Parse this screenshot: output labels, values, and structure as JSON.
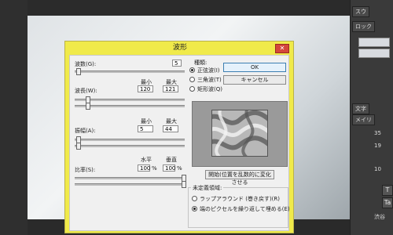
{
  "photoshop": {
    "right_panel_tabs": [
      "スウ",
      "ロック",
      "文字",
      "メイリ"
    ],
    "right_values": [
      "35",
      "19",
      "10"
    ],
    "right_buttons": [
      "T",
      "Ta"
    ],
    "bottom_right_label": "渋谷"
  },
  "dialog": {
    "title": "波形",
    "close_label": "✕",
    "generators": {
      "label": "波数(G):",
      "value": "5"
    },
    "wavelength": {
      "label": "波長(W):",
      "min_label": "最小",
      "max_label": "最大",
      "min": "120",
      "max": "121"
    },
    "amplitude": {
      "label": "振幅(A):",
      "min_label": "最小",
      "max_label": "最大",
      "min": "5",
      "max": "44"
    },
    "scale": {
      "label": "比率(S):",
      "h_label": "水平",
      "v_label": "垂直",
      "h": "100",
      "v": "100",
      "unit": "%"
    },
    "type": {
      "label": "種類:",
      "options": [
        "正弦波(I)",
        "三角波(T)",
        "矩形波(Q)"
      ],
      "selected": 0
    },
    "ok_label": "OK",
    "cancel_label": "キャンセル",
    "randomize_label": "開始(位置を乱数的に変化させる",
    "undefined": {
      "label": "未定義領域:",
      "options": [
        "ラップアラウンド (巻き戻す)(R)",
        "端のピクセルを繰り返して埋める(E)"
      ],
      "selected": 1
    }
  }
}
